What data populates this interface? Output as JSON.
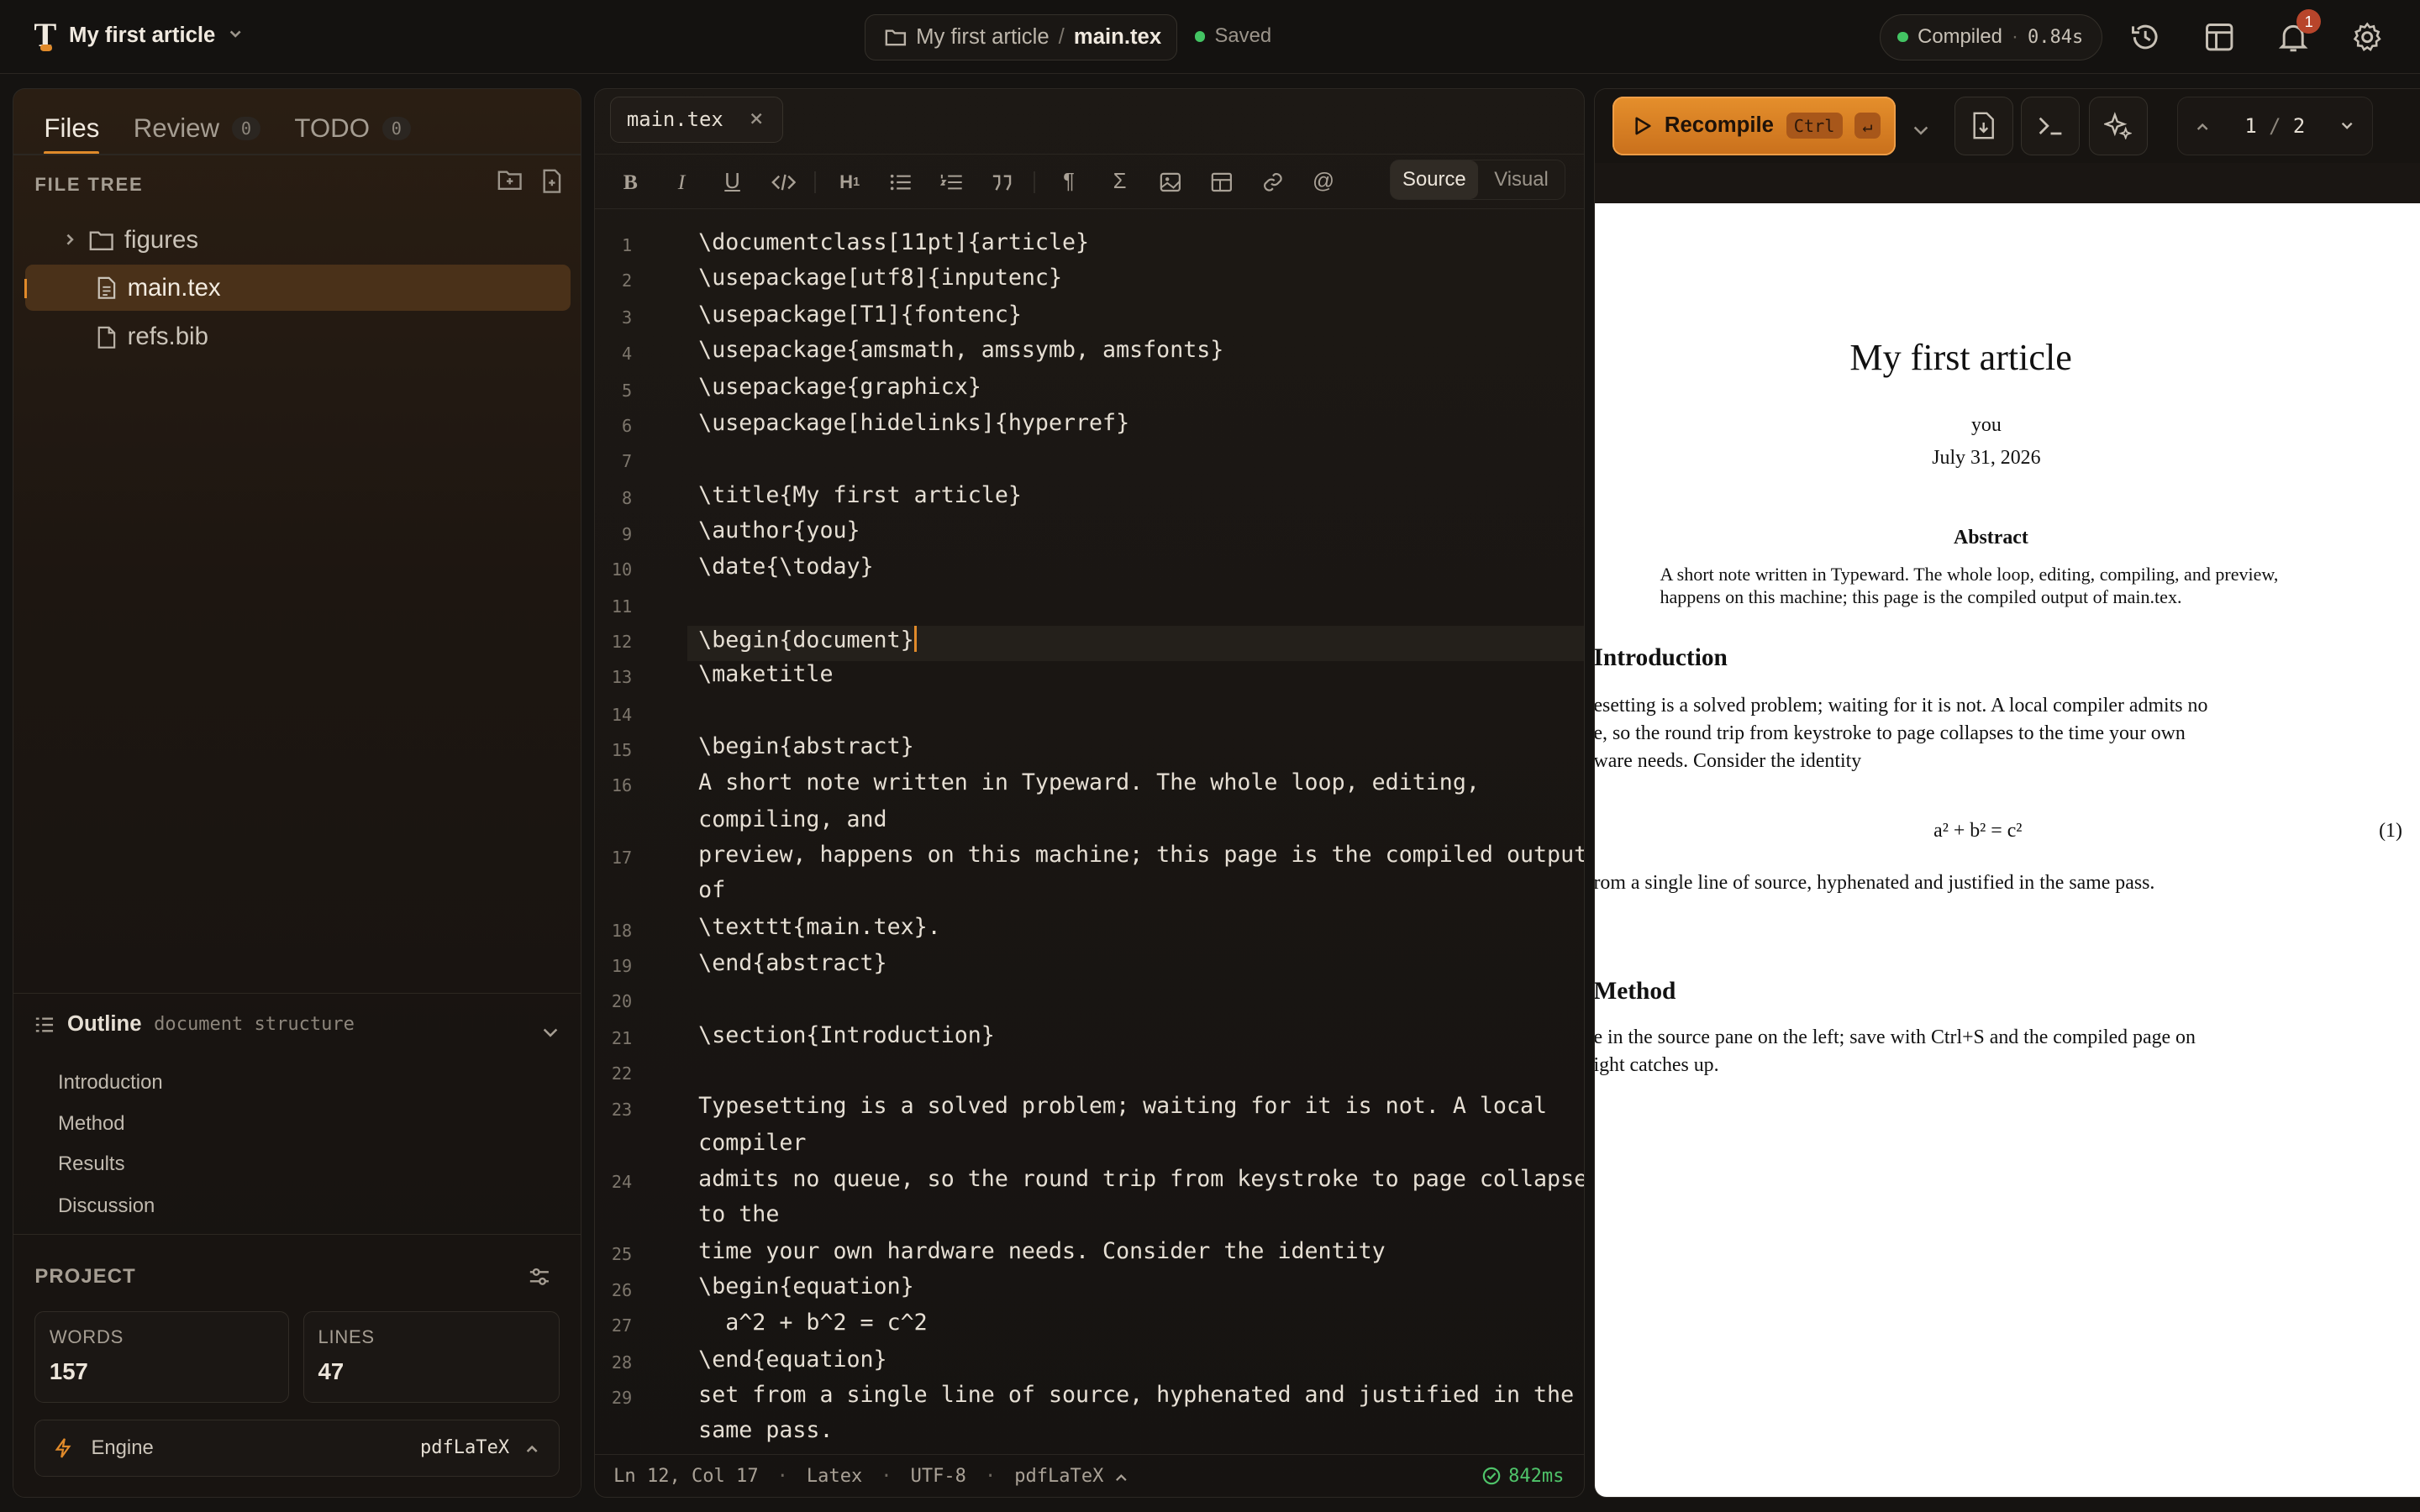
{
  "topbar": {
    "project_title": "My first article",
    "breadcrumb_project": "My first article",
    "breadcrumb_sep": "/",
    "breadcrumb_file": "main.tex",
    "save_status": "Saved",
    "compile_status": "Compiled",
    "compile_sep": "·",
    "compile_time": "0.84s",
    "notifications_count": "1"
  },
  "sidebar": {
    "tabs": [
      {
        "label": "Files",
        "count": ""
      },
      {
        "label": "Review",
        "count": "0"
      },
      {
        "label": "TODO",
        "count": "0"
      }
    ],
    "file_tree_title": "FILE TREE",
    "tree": [
      {
        "label": "figures",
        "type": "folder"
      },
      {
        "label": "main.tex",
        "type": "file"
      },
      {
        "label": "refs.bib",
        "type": "file"
      }
    ],
    "outline_title": "Outline",
    "outline_subtitle": "document structure",
    "outline_items": [
      "Introduction",
      "Method",
      "Results",
      "Discussion"
    ],
    "project_title": "PROJECT",
    "words_label": "WORDS",
    "words_value": "157",
    "lines_label": "LINES",
    "lines_value": "47",
    "engine_label": "Engine",
    "engine_value": "pdfLaTeX"
  },
  "editor": {
    "tab_label": "main.tex",
    "mode_source": "Source",
    "mode_visual": "Visual",
    "line_numbers": [
      "1",
      "2",
      "3",
      "4",
      "5",
      "6",
      "7",
      "8",
      "9",
      "10",
      "11",
      "12",
      "13",
      "14",
      "15",
      "16",
      "17",
      "18",
      "19",
      "20",
      "21",
      "22",
      "23",
      "24",
      "25",
      "26",
      "27",
      "28",
      "29"
    ],
    "lines": [
      "\\documentclass[11pt]{article}",
      "\\usepackage[utf8]{inputenc}",
      "\\usepackage[T1]{fontenc}",
      "\\usepackage{amsmath, amssymb, amsfonts}",
      "\\usepackage{graphicx}",
      "\\usepackage[hidelinks]{hyperref}",
      "",
      "\\title{My first article}",
      "\\author{you}",
      "\\date{\\today}",
      "",
      "\\begin{document}",
      "\\maketitle",
      "",
      "\\begin{abstract}",
      "A short note written in Typeward. The whole loop, editing,",
      "compiling, and",
      "preview, happens on this machine; this page is the compiled output",
      "of",
      "\\texttt{main.tex}.",
      "\\end{abstract}",
      "",
      "\\section{Introduction}",
      "",
      "Typesetting is a solved problem; waiting for it is not. A local",
      "compiler",
      "admits no queue, so the round trip from keystroke to page collapses",
      "to the",
      "time your own hardware needs. Consider the identity",
      "\\begin{equation}",
      "  a^2 + b^2 = c^2",
      "\\end{equation}",
      "set from a single line of source, hyphenated and justified in the",
      "same pass."
    ],
    "status_position": "Ln 12, Col 17",
    "status_sep": "·",
    "status_language": "Latex",
    "status_encoding": "UTF-8",
    "status_engine": "pdfLaTeX",
    "status_time": "842ms"
  },
  "preview": {
    "recompile_label": "Recompile",
    "recompile_shortcut_ctrl": "Ctrl",
    "recompile_shortcut_key": "↵",
    "page_current": "1",
    "page_sep": "/",
    "page_total": "2",
    "doc": {
      "title": "My first article",
      "author": "you",
      "date": "July 31, 2026",
      "abstract_heading": "Abstract",
      "abstract_line1": "A short note written in Typeward. The whole loop, editing, compiling, and preview,",
      "abstract_line2": "happens on this machine; this page is the compiled output of main.tex.",
      "intro_heading": "Introduction",
      "intro_line1": "esetting is a solved problem; waiting for it is not. A local compiler admits no",
      "intro_line2": "e, so the round trip from keystroke to page collapses to the time your own",
      "intro_line3": "ware needs. Consider the identity",
      "equation": "a² + b² = c²",
      "equation_number": "(1)",
      "after_eq": "rom a single line of source, hyphenated and justified in the same pass.",
      "method_heading": "Method",
      "method_line1": "e in the source pane on the left; save with Ctrl+S and the compiled page on",
      "method_line2": "ight catches up."
    }
  },
  "colors": {
    "accent": "#e08a2a",
    "success": "#43c463",
    "selection": "#4a3119"
  }
}
